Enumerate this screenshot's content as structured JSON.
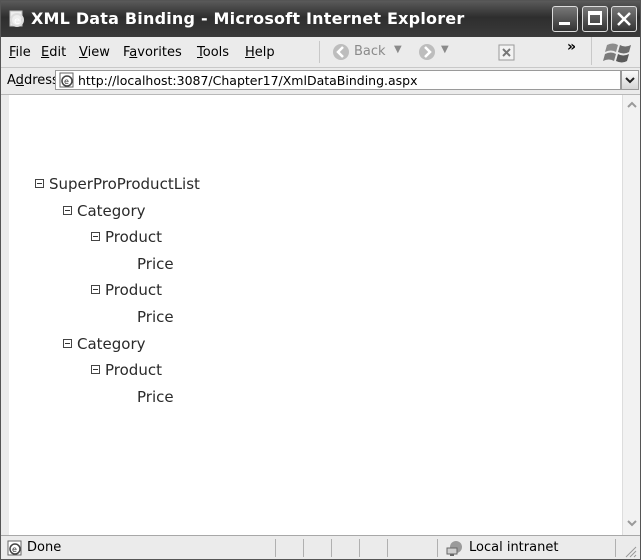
{
  "window": {
    "title": "XML Data Binding - Microsoft Internet Explorer"
  },
  "menu": {
    "items": [
      {
        "key": "F",
        "rest": "ile"
      },
      {
        "key": "E",
        "rest": "dit"
      },
      {
        "key": "V",
        "rest": "iew"
      },
      {
        "pre": "F",
        "key": "a",
        "rest": "vorites"
      },
      {
        "key": "T",
        "rest": "ools"
      },
      {
        "key": "H",
        "rest": "elp"
      }
    ]
  },
  "toolbar": {
    "back_label": "Back",
    "chevron": "»"
  },
  "address": {
    "label_pre": "A",
    "label_key": "d",
    "label_rest": "dress",
    "url": "http://localhost:3087/Chapter17/XmlDataBinding.aspx"
  },
  "tree": {
    "root": "SuperProProductList",
    "category": "Category",
    "product": "Product",
    "price": "Price"
  },
  "status": {
    "text": "Done",
    "zone": "Local intranet"
  }
}
